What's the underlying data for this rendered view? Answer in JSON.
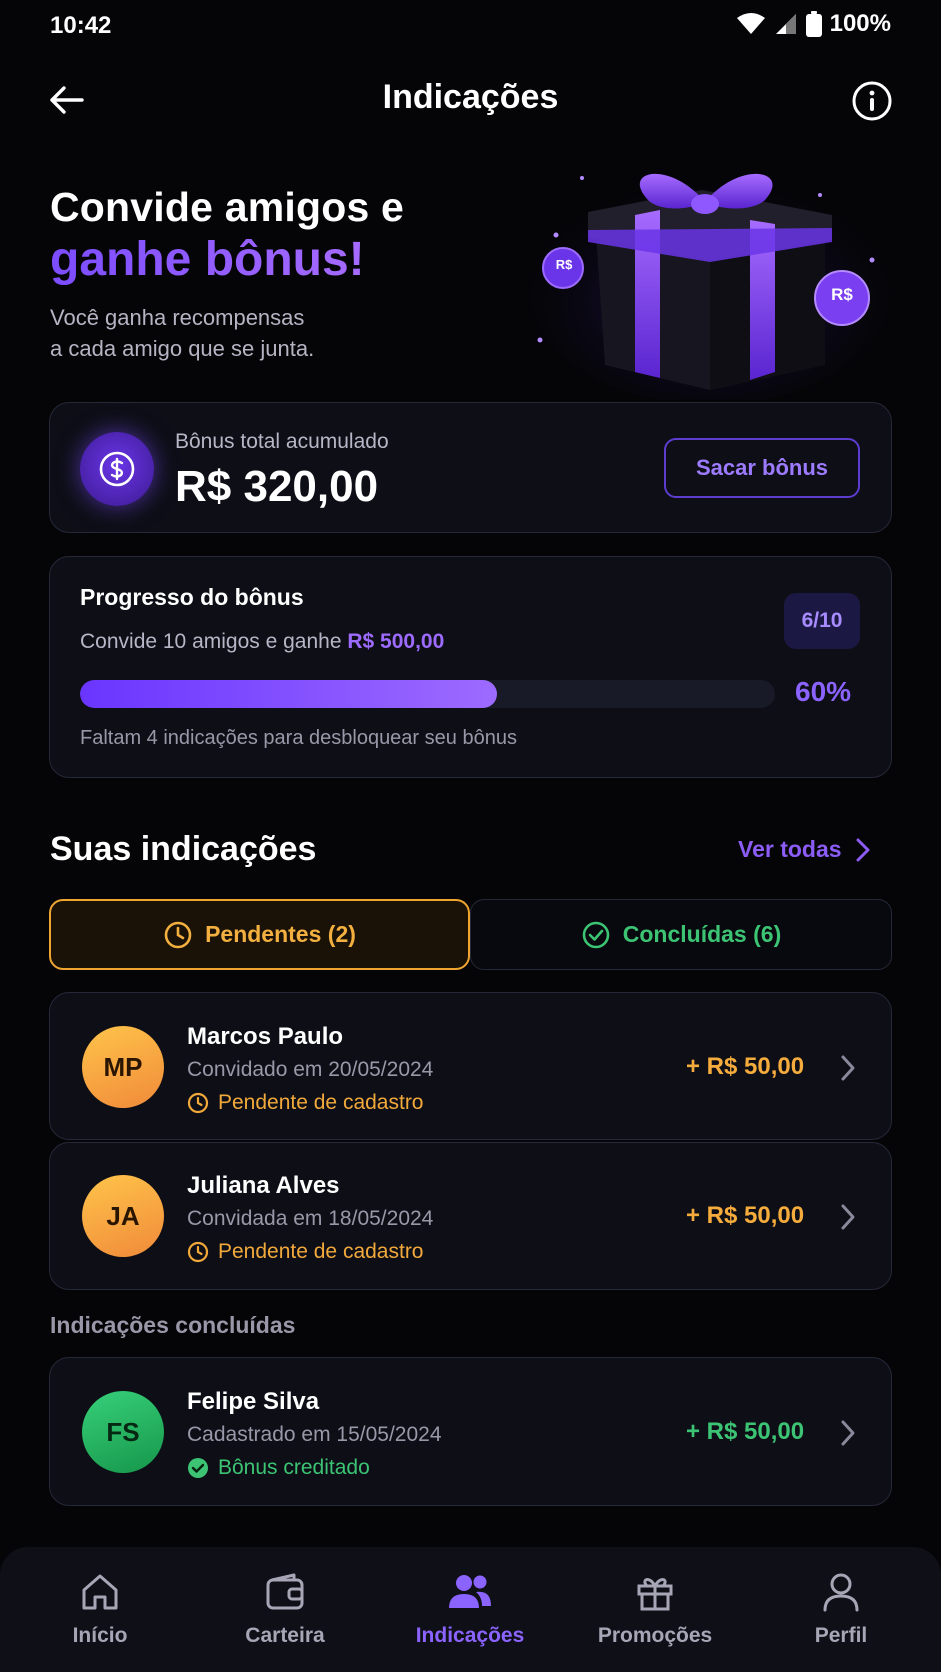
{
  "status_bar": {
    "time": "10:42",
    "battery": "100%"
  },
  "header": {
    "title": "Indicações"
  },
  "hero": {
    "line1": "Convide amigos e",
    "line2": "ganhe bônus!",
    "subtitle_line1": "Você ganha recompensas",
    "subtitle_line2": "a cada amigo que se junta.",
    "coin_label": "R$"
  },
  "bonus": {
    "label": "Bônus total acumulado",
    "value": "R$ 320,00",
    "withdraw_label": "Sacar bônus"
  },
  "progress": {
    "title": "Progresso do bônus",
    "desc_prefix": "Convide 10 amigos e ganhe ",
    "desc_amount": "R$ 500,00",
    "badge": "6/10",
    "percent_label": "60%",
    "fraction": 0.6,
    "note": "Faltam 4 indicações para desbloquear seu bônus"
  },
  "referrals_section": {
    "title": "Suas indicações",
    "see_all": "Ver todas",
    "tabs": {
      "pending": "Pendentes (2)",
      "done": "Concluídas (6)"
    },
    "pending": [
      {
        "initials": "MP",
        "name": "Marcos Paulo",
        "date": "Convidado em 20/05/2024",
        "status": "Pendente de cadastro",
        "amount": "+ R$ 50,00"
      },
      {
        "initials": "JA",
        "name": "Juliana Alves",
        "date": "Convidada em 18/05/2024",
        "status": "Pendente de cadastro",
        "amount": "+ R$ 50,00"
      }
    ],
    "completed_title": "Indicações concluídas",
    "completed": [
      {
        "initials": "FS",
        "name": "Felipe Silva",
        "date": "Cadastrado em 15/05/2024",
        "status": "Bônus creditado",
        "amount": "+ R$ 50,00"
      }
    ]
  },
  "nav": {
    "items": [
      {
        "label": "Início",
        "icon": "home-icon"
      },
      {
        "label": "Carteira",
        "icon": "wallet-icon"
      },
      {
        "label": "Indicações",
        "icon": "users-icon"
      },
      {
        "label": "Promoções",
        "icon": "gift-icon"
      },
      {
        "label": "Perfil",
        "icon": "profile-icon"
      }
    ]
  },
  "colors": {
    "accent": "#8b5cf6",
    "pending": "#f2a93b",
    "success": "#3cc474",
    "background": "#050508"
  }
}
